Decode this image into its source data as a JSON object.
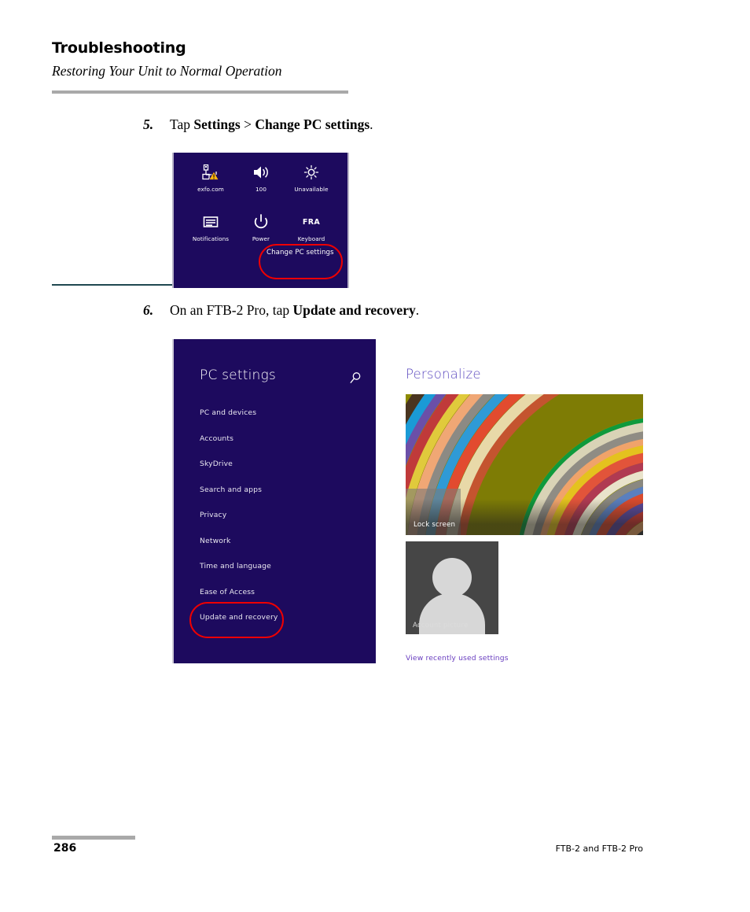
{
  "header": {
    "chapter": "Troubleshooting",
    "section": "Restoring Your Unit to Normal Operation"
  },
  "steps": [
    {
      "number": "5.",
      "prefix": "Tap ",
      "bold1": "Settings",
      "middle": " > ",
      "bold2": "Change PC settings",
      "suffix": "."
    },
    {
      "number": "6.",
      "prefix": "On an FTB-2 Pro, tap ",
      "bold1": "Update and recovery",
      "middle": "",
      "bold2": "",
      "suffix": "."
    }
  ],
  "settings_charm": {
    "tiles": [
      {
        "icon": "network-warning-icon",
        "label": "exfo.com"
      },
      {
        "icon": "volume-icon",
        "label": "100"
      },
      {
        "icon": "brightness-icon",
        "label": "Unavailable"
      },
      {
        "icon": "notifications-icon",
        "label": "Notifications"
      },
      {
        "icon": "power-icon",
        "label": "Power"
      },
      {
        "icon": "keyboard-layout-icon",
        "label": "Keyboard",
        "glyph_text": "FRA"
      }
    ],
    "change_pc_settings": "Change PC settings",
    "highlight_color": "#ee0000",
    "background_color": "#1d0a5e"
  },
  "pc_settings": {
    "title": "PC settings",
    "search_icon": "search-icon",
    "nav_items": [
      "PC and devices",
      "Accounts",
      "SkyDrive",
      "Search and apps",
      "Privacy",
      "Network",
      "Time and language",
      "Ease of Access",
      "Update and recovery"
    ],
    "highlighted_item": "Update and recovery",
    "background_color": "#1d0a5e"
  },
  "personalize": {
    "title": "Personalize",
    "title_color": "#5b49bf",
    "lock_screen_label": "Lock screen",
    "account_picture_label": "Account picture",
    "recent_link": "View recently used settings",
    "link_color": "#6a3fc0"
  },
  "footer": {
    "page_number": "286",
    "product": "FTB-2 and FTB-2 Pro"
  }
}
